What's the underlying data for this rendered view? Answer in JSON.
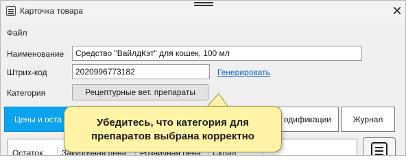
{
  "window": {
    "title": "Карточка товара",
    "close_glyph": "✕"
  },
  "menu": {
    "file_label": "Файл"
  },
  "form": {
    "name_label": "Наименование",
    "name_value": "Средство \"ВайлдКэт\" для кошек, 100 мл",
    "barcode_label": "Штрих-код",
    "barcode_value": "2020996773182",
    "generate_link": "Генерировать",
    "category_label": "Категория",
    "category_value": "Рецептурные вет. препараты"
  },
  "tabs": [
    {
      "label": "Цены и оста",
      "active": true
    },
    {
      "label": "одификации",
      "active": false
    },
    {
      "label": "Журнал",
      "active": false
    }
  ],
  "grid": {
    "columns": [
      "Остаток",
      "Закупочная цена",
      "Розничная цена",
      "Склад"
    ]
  },
  "tooltip": {
    "line1": "Убедитесь, что категория для",
    "line2": "препаратов выбрана корректно"
  },
  "colors": {
    "active_tab": "#0ba3ee",
    "link": "#0b62d6",
    "tooltip_bg": "#fff3a6"
  },
  "icons": {
    "app": "list-window-icon",
    "side_button": "document-list-icon"
  }
}
